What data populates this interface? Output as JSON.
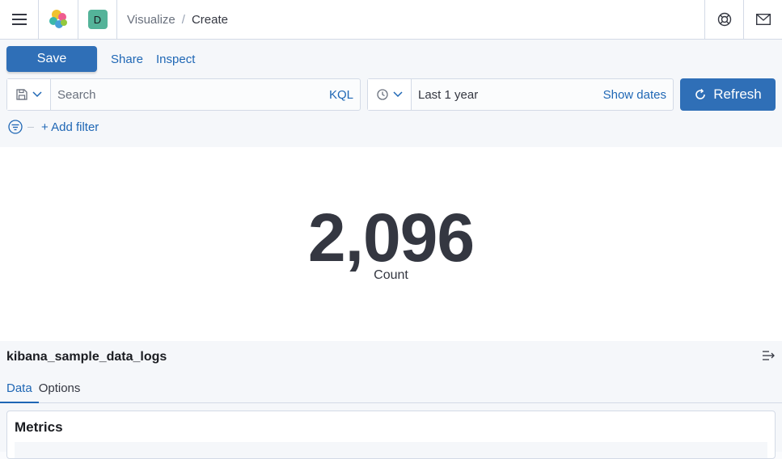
{
  "header": {
    "avatar_letter": "D",
    "breadcrumbs": [
      "Visualize",
      "Create"
    ],
    "breadcrumb_separator": "/"
  },
  "toolbar": {
    "save_label": "Save",
    "share_label": "Share",
    "inspect_label": "Inspect"
  },
  "query": {
    "placeholder": "Search",
    "language": "KQL"
  },
  "datepicker": {
    "range": "Last 1 year",
    "show_dates_label": "Show dates"
  },
  "refresh_label": "Refresh",
  "filters": {
    "add_filter_label": "+ Add filter"
  },
  "metric": {
    "value": "2,096",
    "label": "Count"
  },
  "editor": {
    "index_pattern": "kibana_sample_data_logs",
    "tabs": [
      "Data",
      "Options"
    ],
    "active_tab": "Data",
    "metrics_title": "Metrics"
  },
  "colors": {
    "primary": "#2f6fb7",
    "link": "#1f67b5",
    "avatar": "#54b399",
    "text": "#343741"
  },
  "icons": [
    "menu-icon",
    "elastic-logo",
    "save-query-icon",
    "calendar-clock-icon",
    "refresh-icon",
    "filter-icon",
    "help-icon",
    "mail-icon",
    "collapse-icon"
  ]
}
